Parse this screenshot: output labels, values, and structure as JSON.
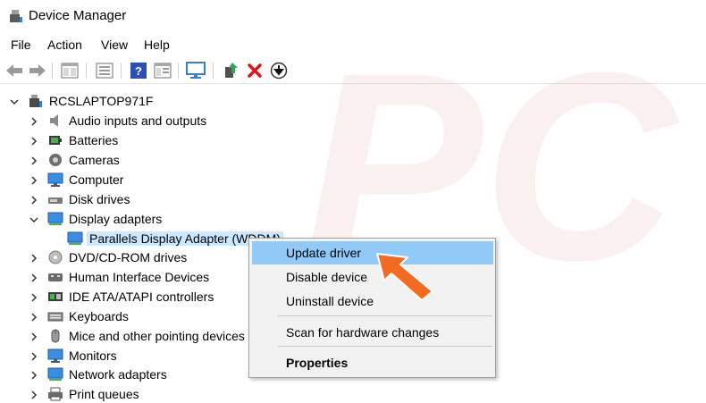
{
  "window": {
    "title": "Device Manager",
    "icon": "device-manager-icon"
  },
  "menubar": {
    "items": [
      "File",
      "Action",
      "View",
      "Help"
    ]
  },
  "toolbar": {
    "buttons": [
      "back-icon",
      "forward-icon",
      "properties-icon",
      "show-hidden-icon",
      "help-icon",
      "view-icon",
      "monitor-icon",
      "update-driver-icon",
      "uninstall-icon",
      "download-icon"
    ]
  },
  "tree": {
    "root": "RCSLAPTOP971F",
    "nodes": [
      {
        "label": "Audio inputs and outputs",
        "icon": "speaker-icon",
        "expanded": false
      },
      {
        "label": "Batteries",
        "icon": "battery-icon",
        "expanded": false
      },
      {
        "label": "Cameras",
        "icon": "camera-icon",
        "expanded": false
      },
      {
        "label": "Computer",
        "icon": "computer-icon",
        "expanded": false
      },
      {
        "label": "Disk drives",
        "icon": "disk-icon",
        "expanded": false
      },
      {
        "label": "Display adapters",
        "icon": "display-adapter-icon",
        "expanded": true
      },
      {
        "label": "Parallels Display Adapter (WDDM)",
        "icon": "display-adapter-icon",
        "child": true,
        "selected": true
      },
      {
        "label": "DVD/CD-ROM drives",
        "icon": "dvd-icon",
        "expanded": false
      },
      {
        "label": "Human Interface Devices",
        "icon": "hid-icon",
        "expanded": false
      },
      {
        "label": "IDE ATA/ATAPI controllers",
        "icon": "ide-icon",
        "expanded": false
      },
      {
        "label": "Keyboards",
        "icon": "keyboard-icon",
        "expanded": false
      },
      {
        "label": "Mice and other pointing devices",
        "icon": "mouse-icon",
        "expanded": false
      },
      {
        "label": "Monitors",
        "icon": "monitor-icon",
        "expanded": false
      },
      {
        "label": "Network adapters",
        "icon": "network-icon",
        "expanded": false
      },
      {
        "label": "Print queues",
        "icon": "printer-icon",
        "expanded": false
      }
    ]
  },
  "context_menu": {
    "items": [
      {
        "label": "Update driver",
        "highlighted": true
      },
      {
        "label": "Disable device"
      },
      {
        "label": "Uninstall device"
      },
      {
        "label": "Scan for hardware changes"
      },
      {
        "label": "Properties",
        "bold": true
      }
    ]
  },
  "colors": {
    "highlight": "#91c9f7",
    "selection": "#cce8ff",
    "arrow": "#f26b21"
  }
}
